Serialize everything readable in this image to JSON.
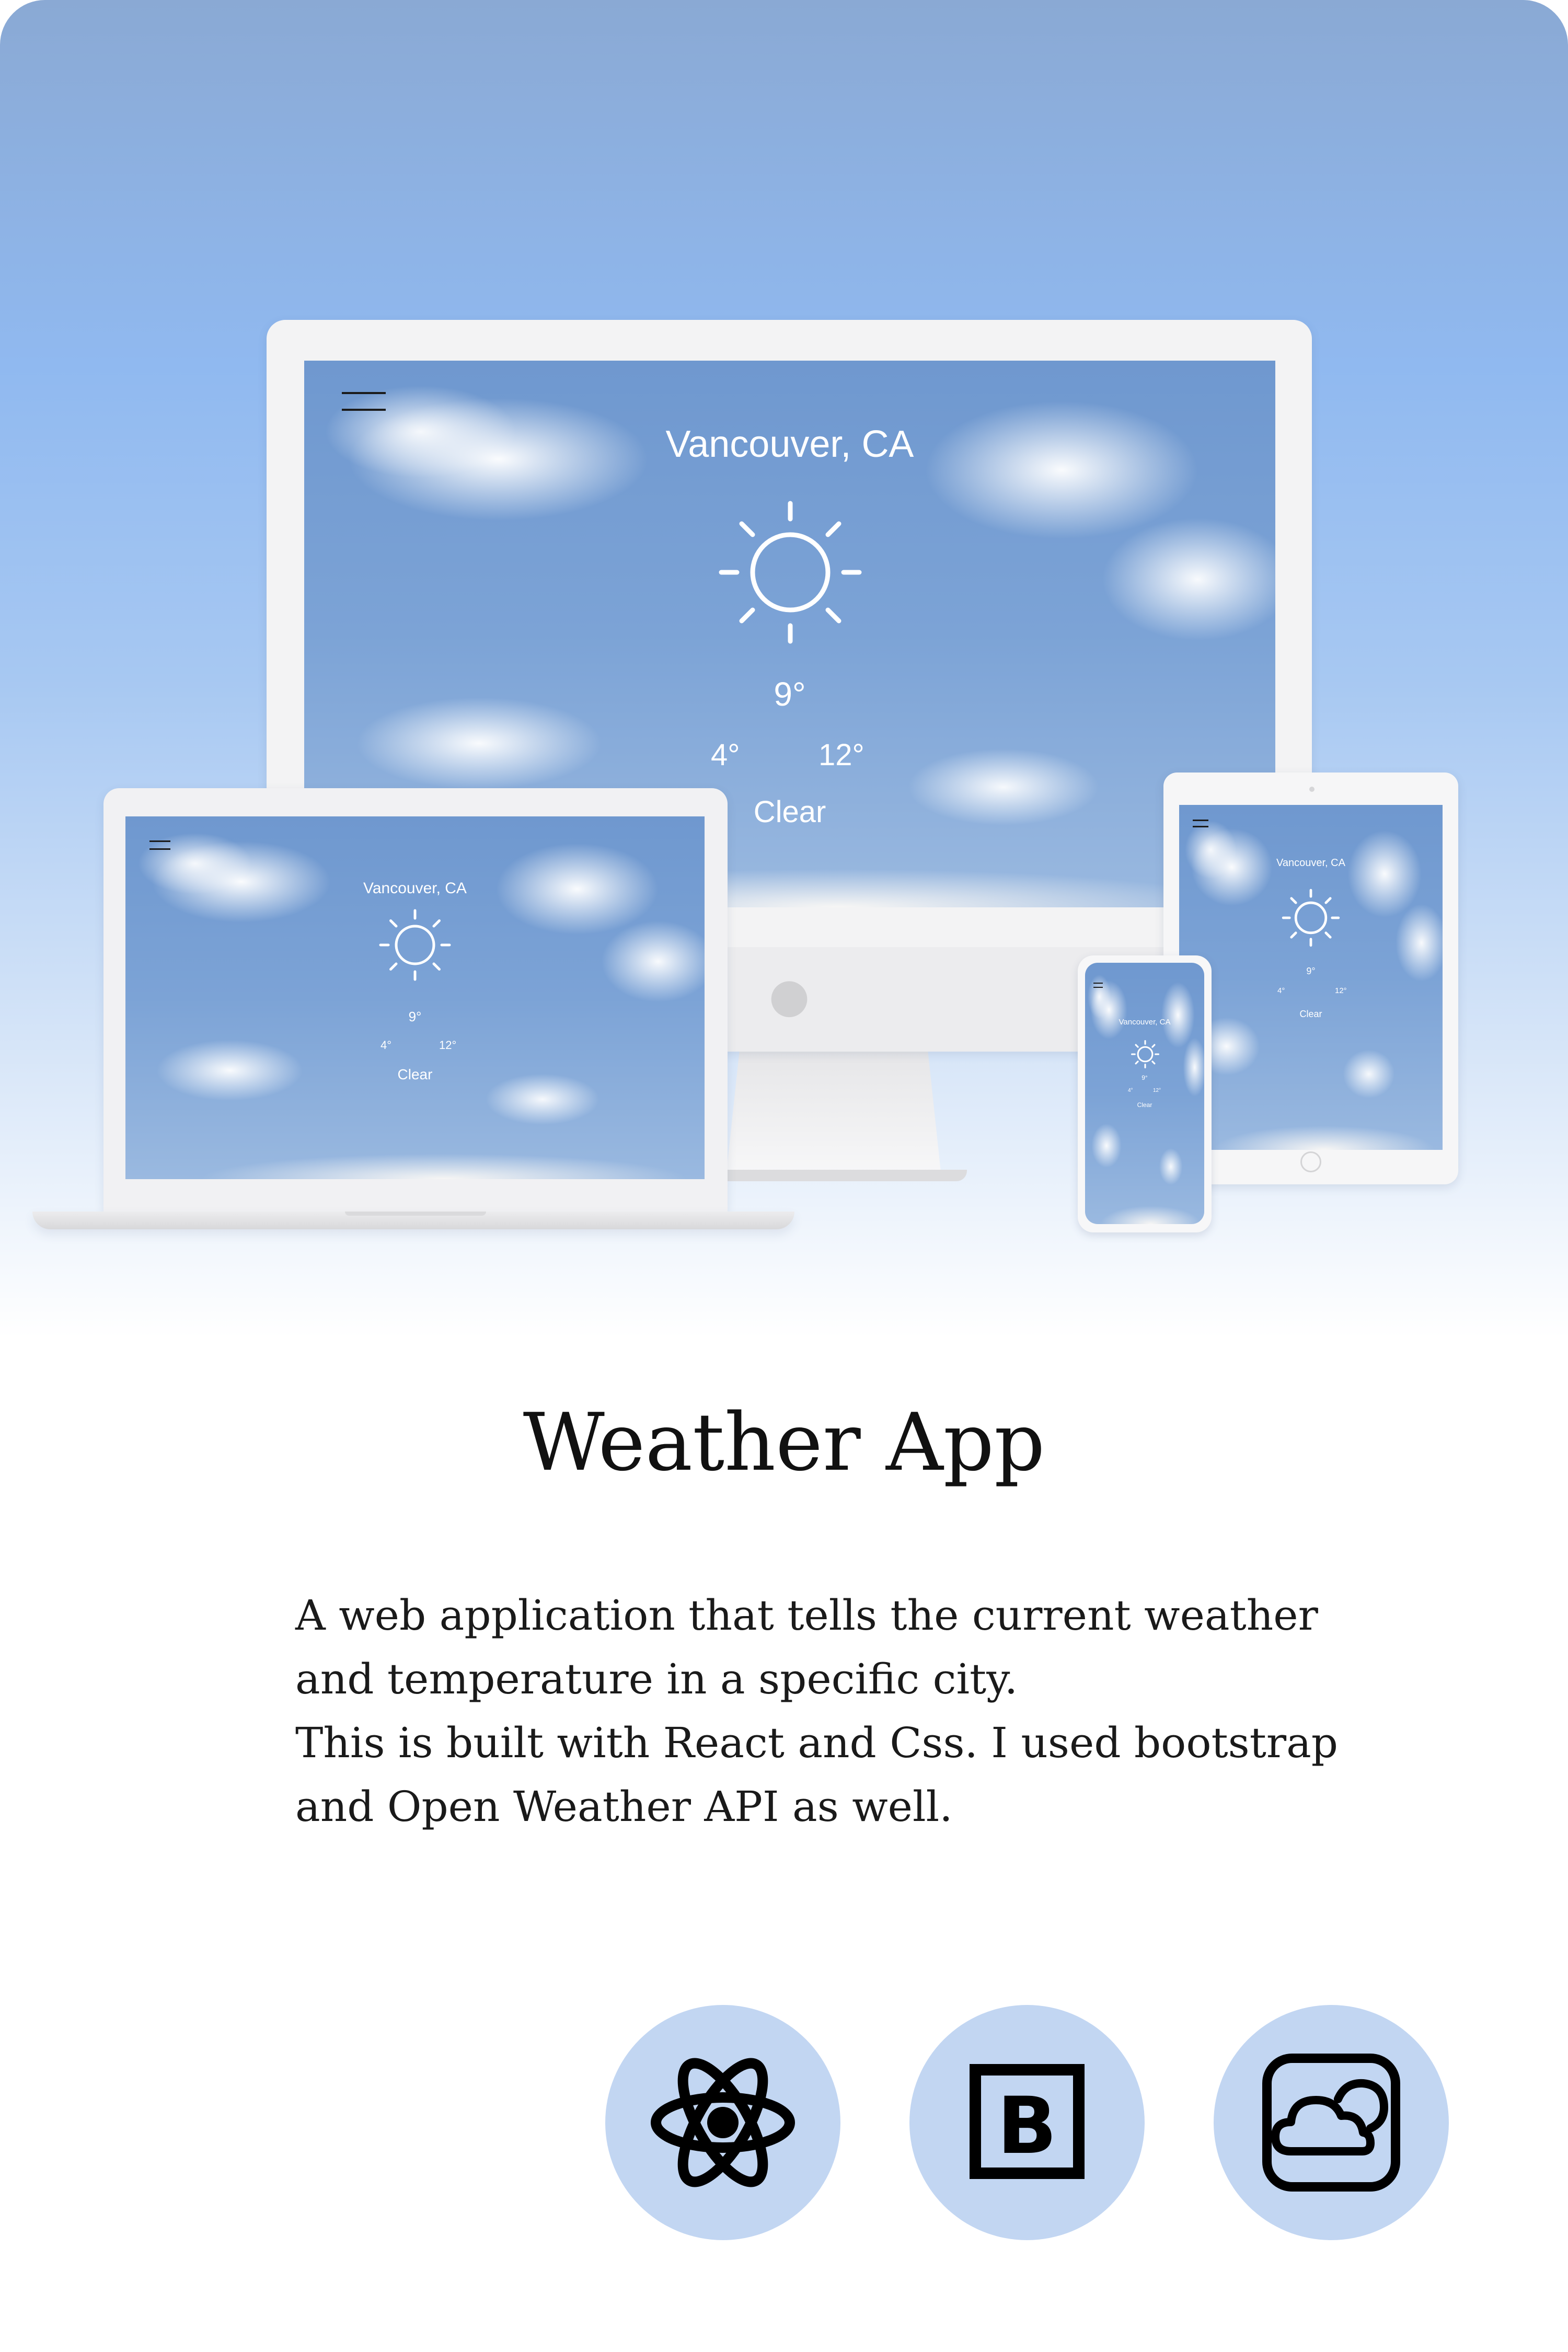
{
  "project": {
    "title": "Weather App",
    "description": [
      "A web application that tells the current weather",
      "and temperature in a specific city.",
      "This is built with React and Css. I used bootstrap",
      "and Open Weather API as well."
    ]
  },
  "weather": {
    "city": "Vancouver, CA",
    "temperature": "9°",
    "low": "4°",
    "high": "12°",
    "condition": "Clear",
    "icon": "sun-icon"
  },
  "tech_icons": [
    "react-icon",
    "bootstrap-icon",
    "weather-api-icon"
  ],
  "colors": {
    "sky_top": "#8aa9d4",
    "sky_mid": "#90b9f0",
    "badge": "#c2d6f2",
    "device": "#f3f3f4",
    "text": "#111111"
  }
}
